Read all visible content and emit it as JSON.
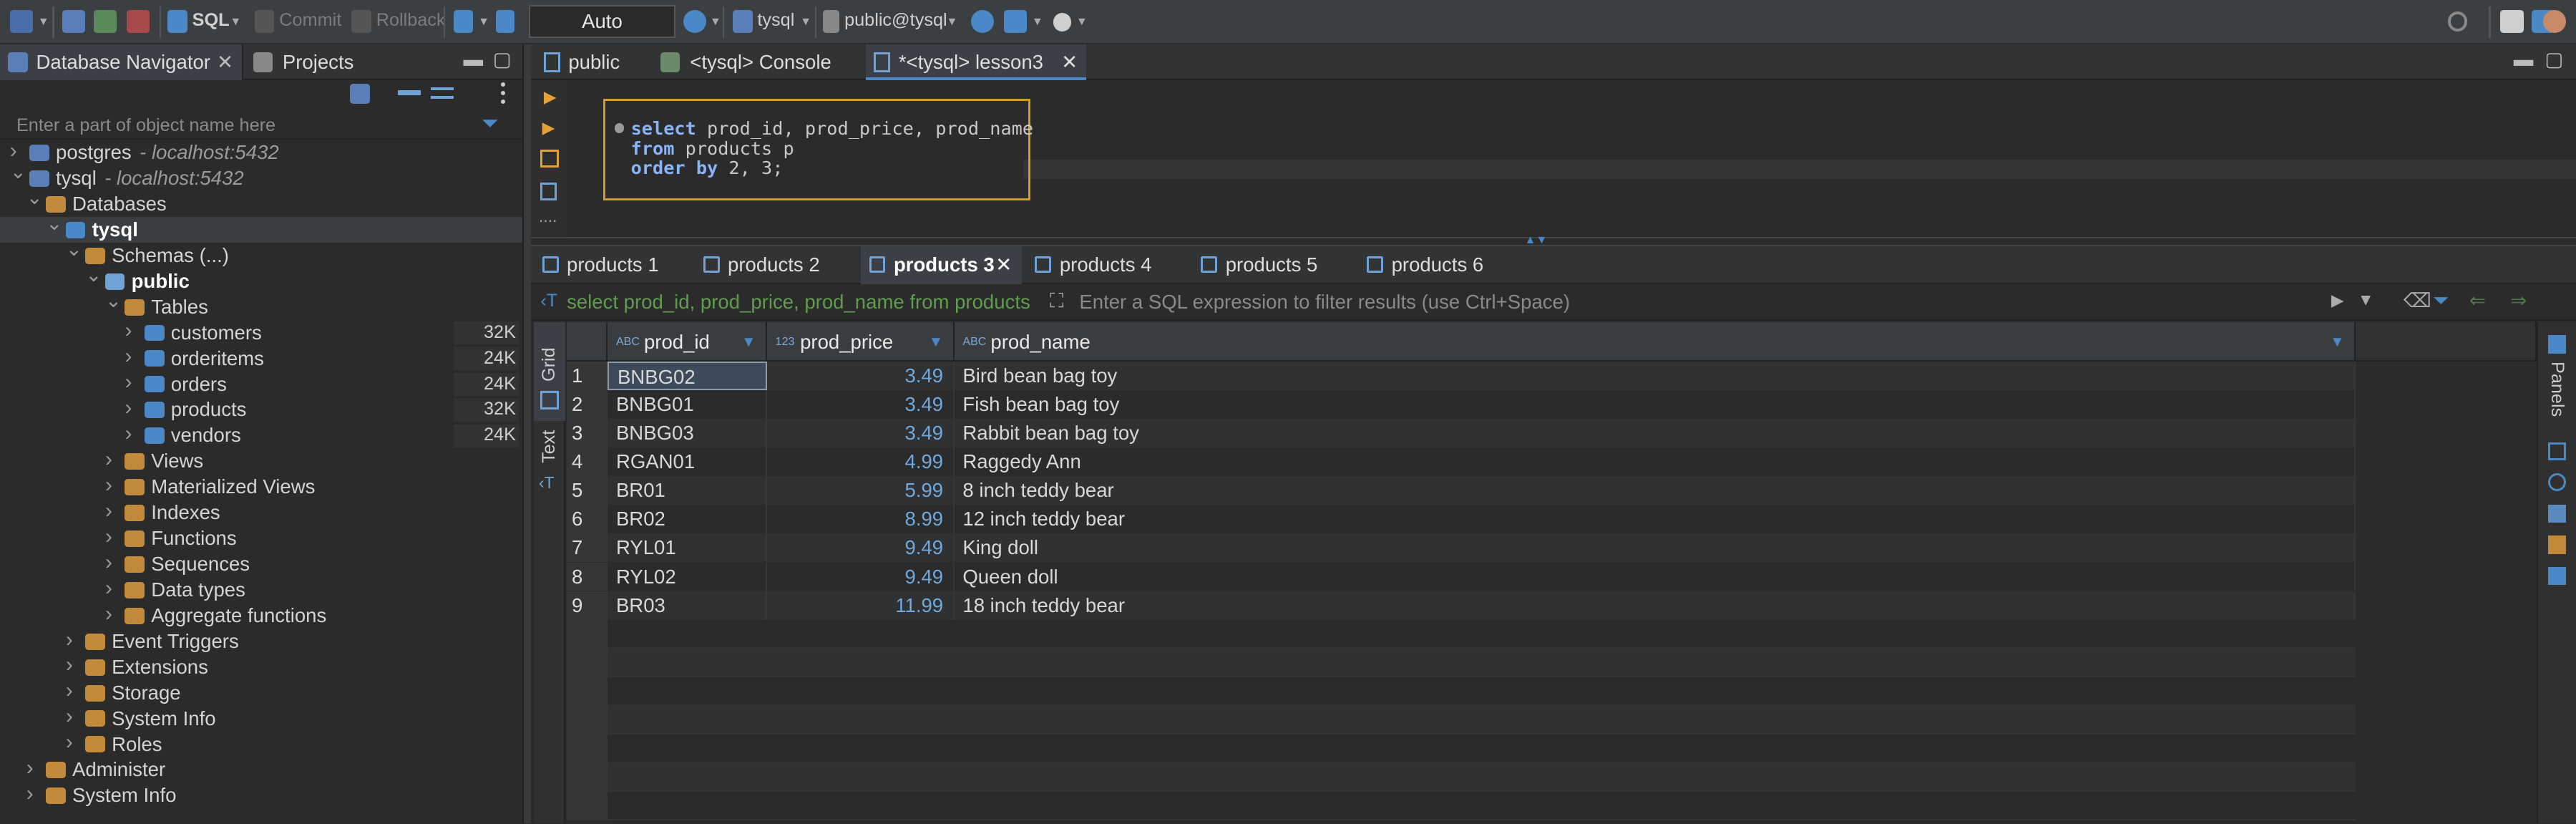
{
  "toolbar": {
    "sql_label": "SQL",
    "commit_label": "Commit",
    "rollback_label": "Rollback",
    "mode_value": "Auto",
    "datasource_label": "tysql",
    "schema_label": "public@tysql"
  },
  "navigator": {
    "tab_label": "Database Navigator",
    "projects_tab_label": "Projects",
    "search_placeholder": "Enter a part of object name here",
    "tree": [
      {
        "label": "postgres",
        "host": "- localhost:5432",
        "size": ""
      },
      {
        "label": "tysql",
        "host": "- localhost:5432",
        "size": ""
      },
      {
        "label": "Databases",
        "host": "",
        "size": ""
      },
      {
        "label": "tysql",
        "host": "",
        "size": ""
      },
      {
        "label": "Schemas (...)",
        "host": "",
        "size": ""
      },
      {
        "label": "public",
        "host": "",
        "size": ""
      },
      {
        "label": "Tables",
        "host": "",
        "size": ""
      },
      {
        "label": "customers",
        "host": "",
        "size": "32K"
      },
      {
        "label": "orderitems",
        "host": "",
        "size": "24K"
      },
      {
        "label": "orders",
        "host": "",
        "size": "24K"
      },
      {
        "label": "products",
        "host": "",
        "size": "32K"
      },
      {
        "label": "vendors",
        "host": "",
        "size": "24K"
      },
      {
        "label": "Views",
        "host": "",
        "size": ""
      },
      {
        "label": "Materialized Views",
        "host": "",
        "size": ""
      },
      {
        "label": "Indexes",
        "host": "",
        "size": ""
      },
      {
        "label": "Functions",
        "host": "",
        "size": ""
      },
      {
        "label": "Sequences",
        "host": "",
        "size": ""
      },
      {
        "label": "Data types",
        "host": "",
        "size": ""
      },
      {
        "label": "Aggregate functions",
        "host": "",
        "size": ""
      },
      {
        "label": "Event Triggers",
        "host": "",
        "size": ""
      },
      {
        "label": "Extensions",
        "host": "",
        "size": ""
      },
      {
        "label": "Storage",
        "host": "",
        "size": ""
      },
      {
        "label": "System Info",
        "host": "",
        "size": ""
      },
      {
        "label": "Roles",
        "host": "",
        "size": ""
      },
      {
        "label": "Administer",
        "host": "",
        "size": ""
      },
      {
        "label": "System Info",
        "host": "",
        "size": ""
      }
    ]
  },
  "editor_tabs": [
    {
      "label": "public"
    },
    {
      "label": "<tysql> Console"
    },
    {
      "label": "*<tysql> lesson3"
    }
  ],
  "sql": {
    "line1_kw": "select",
    "line1_rest": " prod_id, prod_price, prod_name",
    "line2_kw": "from",
    "line2_rest": " products p",
    "line3_kw": "order by",
    "line3_rest": " 2, 3;"
  },
  "result_tabs": [
    {
      "label": "products 1"
    },
    {
      "label": "products 2"
    },
    {
      "label": "products 3"
    },
    {
      "label": "products 4"
    },
    {
      "label": "products 5"
    },
    {
      "label": "products 6"
    }
  ],
  "filter": {
    "query": "select prod_id, prod_price, prod_name from products",
    "placeholder": "Enter a SQL expression to filter results (use Ctrl+Space)"
  },
  "side": {
    "grid_label": "Grid",
    "text_label": "Text",
    "panels_label": "Panels"
  },
  "grid": {
    "columns": [
      {
        "type": "ABC",
        "name": "prod_id"
      },
      {
        "type": "123",
        "name": "prod_price"
      },
      {
        "type": "ABC",
        "name": "prod_name"
      }
    ],
    "rows": [
      {
        "n": "1",
        "prod_id": "BNBG02",
        "prod_price": "3.49",
        "prod_name": "Bird bean bag toy"
      },
      {
        "n": "2",
        "prod_id": "BNBG01",
        "prod_price": "3.49",
        "prod_name": "Fish bean bag toy"
      },
      {
        "n": "3",
        "prod_id": "BNBG03",
        "prod_price": "3.49",
        "prod_name": "Rabbit bean bag toy"
      },
      {
        "n": "4",
        "prod_id": "RGAN01",
        "prod_price": "4.99",
        "prod_name": "Raggedy Ann"
      },
      {
        "n": "5",
        "prod_id": "BR01",
        "prod_price": "5.99",
        "prod_name": "8 inch teddy bear"
      },
      {
        "n": "6",
        "prod_id": "BR02",
        "prod_price": "8.99",
        "prod_name": "12 inch teddy bear"
      },
      {
        "n": "7",
        "prod_id": "RYL01",
        "prod_price": "9.49",
        "prod_name": "King doll"
      },
      {
        "n": "8",
        "prod_id": "RYL02",
        "prod_price": "9.49",
        "prod_name": "Queen doll"
      },
      {
        "n": "9",
        "prod_id": "BR03",
        "prod_price": "11.99",
        "prod_name": "18 inch teddy bear"
      }
    ]
  }
}
